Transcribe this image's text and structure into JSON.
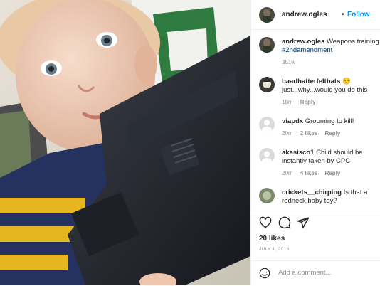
{
  "header": {
    "username": "andrew.ogles",
    "separator": "•",
    "follow": "Follow"
  },
  "caption": {
    "username": "andrew.ogles",
    "text": "Weapons training",
    "hashtag": "#2ndamendment",
    "time": "351w"
  },
  "comments": [
    {
      "username": "baadhatterfeltha ts",
      "text": "just...why...would you do this",
      "time": "18m",
      "likes": "",
      "reply": "Reply"
    },
    {
      "username": "viapdx",
      "text": "Grooming to kill!",
      "time": "20m",
      "likes": "2 likes",
      "reply": "Reply"
    },
    {
      "username": "akasisco1",
      "text": "Child should be instantly taken by CPC",
      "time": "20m",
      "likes": "4 likes",
      "reply": "Reply"
    },
    {
      "username": "crickets__chirping",
      "text": "Is that a redneck baby toy?",
      "time": "",
      "likes": "",
      "reply": ""
    }
  ],
  "actions": {
    "likes": "20 likes",
    "date": "JULY 1, 2016"
  },
  "composer": {
    "placeholder": "Add a comment..."
  },
  "icons": {
    "like": "heart-icon",
    "comment": "comment-bubble-icon",
    "share": "paper-plane-icon",
    "emoji": "smiley-icon"
  },
  "colors": {
    "link": "#0095f6",
    "hashtag": "#00376b",
    "muted": "#8e8e8e",
    "text": "#262626"
  }
}
